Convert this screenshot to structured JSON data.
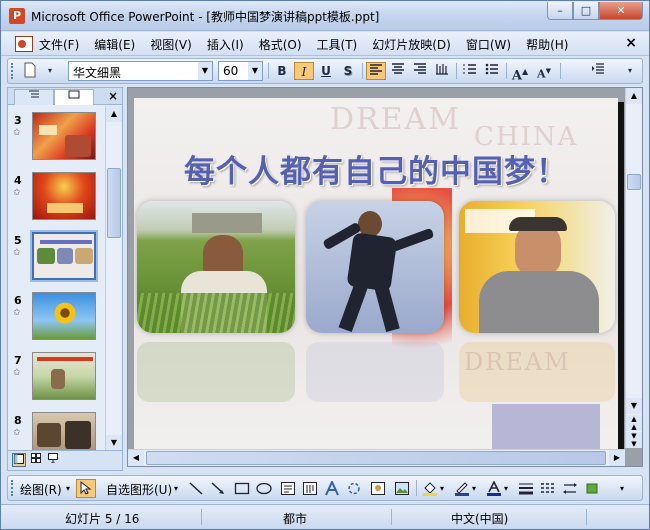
{
  "window": {
    "title": "Microsoft Office PowerPoint - [教师中国梦演讲稿ppt模板.ppt]",
    "controls": {
      "minimize": "–",
      "maximize": "□",
      "close": "✕"
    }
  },
  "menubar": {
    "items": [
      "文件(F)",
      "编辑(E)",
      "视图(V)",
      "插入(I)",
      "格式(O)",
      "工具(T)",
      "幻灯片放映(D)",
      "窗口(W)",
      "帮助(H)"
    ],
    "close_glyph": "×"
  },
  "toolbar": {
    "font_name": "华文细黑",
    "font_size": "60",
    "bold": "B",
    "italic": "I",
    "underline": "U",
    "shadow": "S",
    "italic_active": true
  },
  "leftpanel": {
    "tabs": [
      "outline",
      "slides"
    ],
    "close_glyph": "×",
    "thumbnails": [
      {
        "number": "3",
        "selected": false
      },
      {
        "number": "4",
        "selected": false
      },
      {
        "number": "5",
        "selected": true
      },
      {
        "number": "6",
        "selected": false
      },
      {
        "number": "7",
        "selected": false
      },
      {
        "number": "8",
        "selected": false
      }
    ],
    "star": "✩"
  },
  "slide": {
    "title": "每个人都有自己的中国梦！",
    "watermark_1": "DREAM",
    "watermark_2": "CHINA",
    "watermark_3": "DREAM"
  },
  "drawbar": {
    "draw_label": "绘图(R)",
    "autoshapes_label": "自选图形(U)"
  },
  "statusbar": {
    "slide_info": "幻灯片 5 / 16",
    "design": "都市",
    "language": "中文(中国)"
  },
  "colors": {
    "title": "#5560b5",
    "accent_red": "#d24726",
    "chrome": "#d6e3f5"
  }
}
